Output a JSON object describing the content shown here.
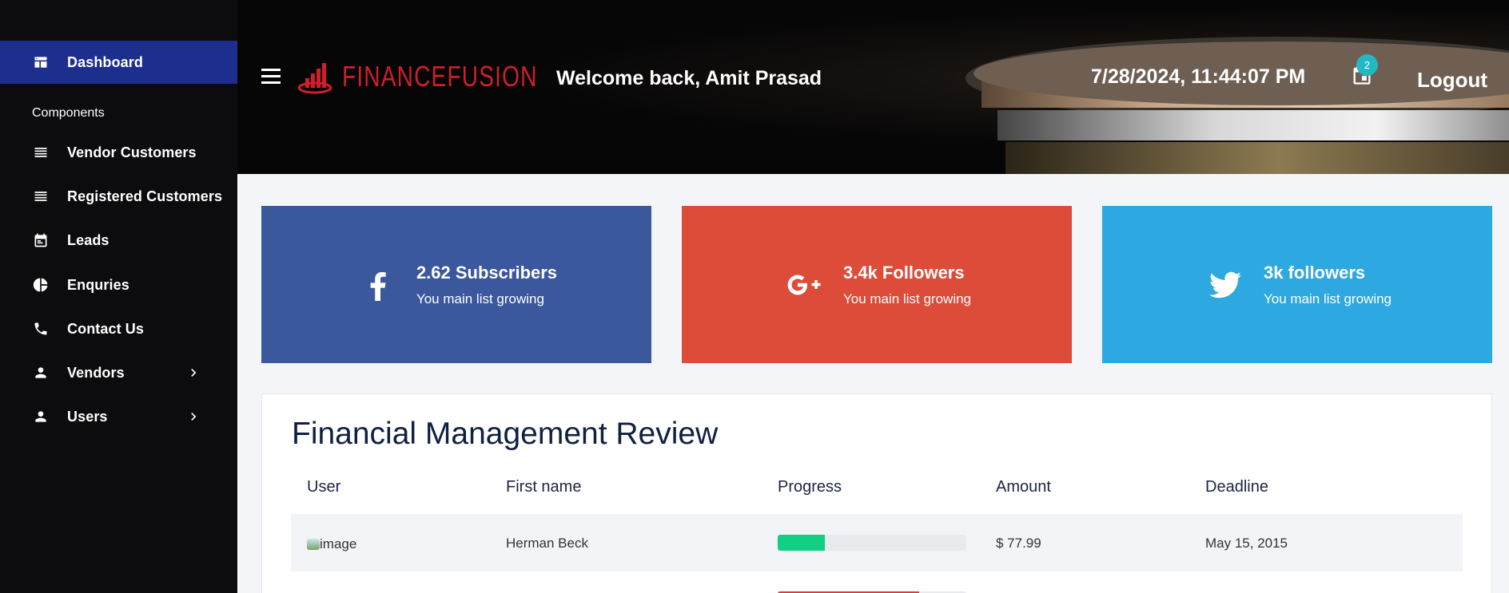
{
  "sidebar": {
    "items": [
      {
        "label": "Dashboard",
        "icon": "dashboard-icon",
        "active": true
      },
      {
        "label": "Vendor Customers",
        "icon": "list-icon"
      },
      {
        "label": "Registered Customers",
        "icon": "list-icon"
      },
      {
        "label": "Leads",
        "icon": "calendar-icon"
      },
      {
        "label": "Enquries",
        "icon": "pie-chart-icon"
      },
      {
        "label": "Contact Us",
        "icon": "phone-icon"
      },
      {
        "label": "Vendors",
        "icon": "person-icon",
        "expandable": true
      },
      {
        "label": "Users",
        "icon": "person-icon",
        "expandable": true
      }
    ],
    "section_label": "Components"
  },
  "header": {
    "logo_text": "FINANCEFUSION",
    "welcome": "Welcome back, Amit Prasad",
    "datetime": "7/28/2024, 11:44:07 PM",
    "notification_count": "2",
    "logout": "Logout"
  },
  "cards": [
    {
      "icon": "facebook-icon",
      "title": "2.62 Subscribers",
      "subtitle": "You main list growing",
      "color": "#3b579d"
    },
    {
      "icon": "google-plus-icon",
      "title": "3.4k Followers",
      "subtitle": "You main list growing",
      "color": "#dd4b39"
    },
    {
      "icon": "twitter-icon",
      "title": "3k followers",
      "subtitle": "You main list growing",
      "color": "#2ea8e0"
    }
  ],
  "table": {
    "title": "Financial Management Review",
    "headers": [
      "User",
      "First name",
      "Progress",
      "Amount",
      "Deadline"
    ],
    "rows": [
      {
        "user_image_alt": "image",
        "first_name": "Herman Beck",
        "progress": 0.25,
        "amount": "$ 77.99",
        "deadline": "May 15, 2015"
      }
    ],
    "partial_row_progress": 0.75
  },
  "colors": {
    "sidebar_bg": "#0c0c0e",
    "active_item": "#1c2f8f",
    "brand": "#d01f2a",
    "progress_green": "#12cf83",
    "progress_red": "#e03a3a",
    "badge": "#23b8c3"
  }
}
